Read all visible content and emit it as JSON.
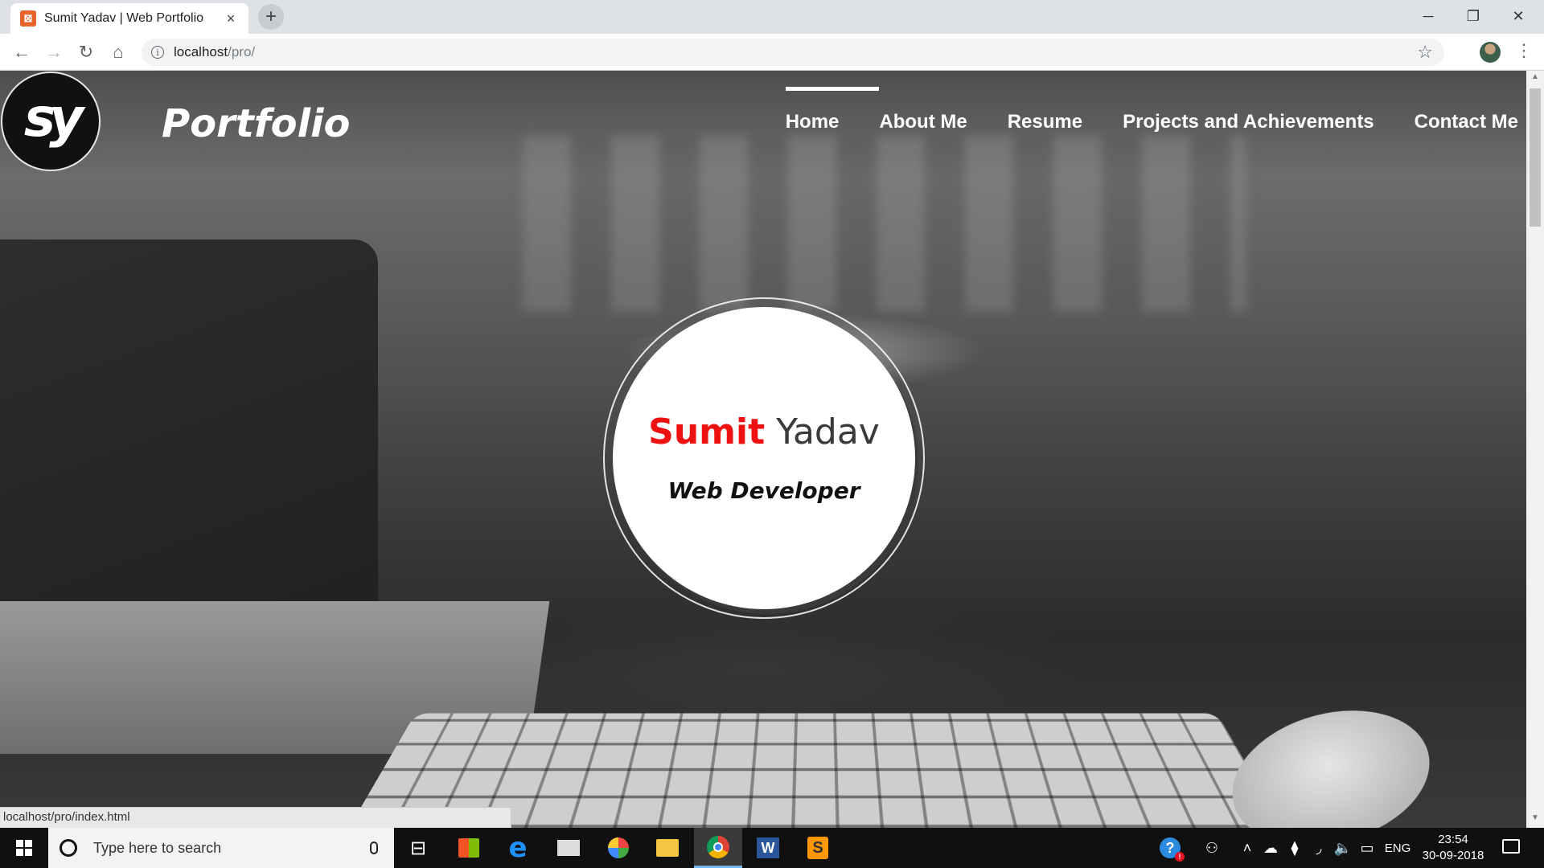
{
  "browser": {
    "tab_title": "Sumit Yadav | Web Portfolio",
    "tab_favicon_glyph": "⊠",
    "tab_close": "×",
    "new_tab": "+",
    "url_host": "localhost",
    "url_path": "/pro/",
    "status_url": "localhost/pro/index.html",
    "window_controls": {
      "minimize": "─",
      "restore": "❐",
      "close": "✕"
    },
    "nav_icons": {
      "back": "←",
      "forward": "→",
      "reload": "↻",
      "home": "⌂",
      "info": "i",
      "star": "☆",
      "menu": "⋮"
    }
  },
  "site": {
    "logo_text": "sy",
    "brand": "Portfolio",
    "nav": [
      {
        "label": "Home",
        "active": true
      },
      {
        "label": "About Me"
      },
      {
        "label": "Resume"
      },
      {
        "label": "Projects and Achievements"
      },
      {
        "label": "Contact Me"
      }
    ],
    "hero": {
      "first_name": "Sumit",
      "last_name": "Yadav",
      "role": "Web Developer",
      "first_name_color": "#ee1111"
    }
  },
  "taskbar": {
    "search_placeholder": "Type here to search",
    "language": "ENG",
    "time": "23:54",
    "date": "30-09-2018",
    "tray_icons": [
      "help-icon",
      "people-icon",
      "chevron-up-icon",
      "onedrive-icon",
      "dropbox-icon",
      "wifi-icon",
      "volume-icon",
      "battery-icon"
    ],
    "pinned_apps": [
      "task-view",
      "microsoft-store",
      "edge",
      "mail",
      "paint",
      "file-explorer",
      "chrome",
      "word",
      "sublime-text"
    ],
    "active_app": "chrome"
  }
}
